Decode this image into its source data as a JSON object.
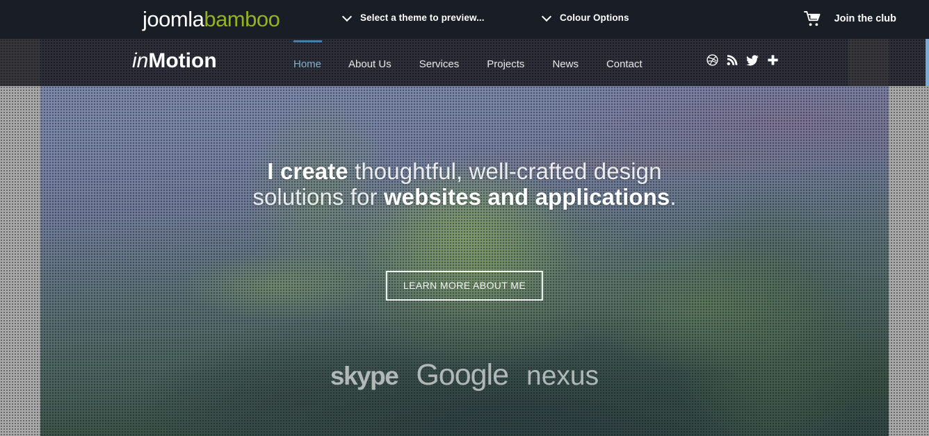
{
  "topbar": {
    "logo": {
      "part1": "joomla",
      "part2": "bamboo",
      "part1_color": "#ffffff",
      "part2_color": "#93b31d"
    },
    "theme_select_label": "Select a theme to preview...",
    "colour_options_label": "Colour Options",
    "join_club_label": "Join the club",
    "background_color": "#191d25"
  },
  "navbar": {
    "site_logo": {
      "italic": "in",
      "bold": "Motion"
    },
    "menu": [
      {
        "label": "Home",
        "active": true
      },
      {
        "label": "About Us",
        "active": false
      },
      {
        "label": "Services",
        "active": false
      },
      {
        "label": "Projects",
        "active": false
      },
      {
        "label": "News",
        "active": false
      },
      {
        "label": "Contact",
        "active": false
      }
    ],
    "social": [
      "dribbble-icon",
      "rss-icon",
      "twitter-icon",
      "plus-icon"
    ],
    "active_color": "#7fb2d1",
    "background_color": "#2c2f3a"
  },
  "hero": {
    "headline_line1_bold": "I create",
    "headline_line1_rest": " thoughtful, well-crafted design",
    "headline_line2_pre": "solutions for ",
    "headline_line2_bold": "websites and applications",
    "headline_line2_post": ".",
    "cta_label": "LEARN MORE ABOUT ME",
    "clients": [
      "skype",
      "Google",
      "nexus"
    ]
  }
}
